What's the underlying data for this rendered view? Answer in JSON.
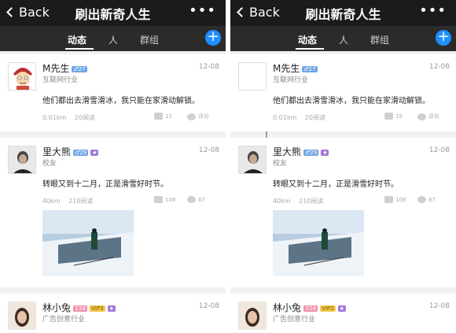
{
  "header": {
    "back_label": "Back",
    "title": "刷出新奇人生",
    "more": "•••"
  },
  "tabs": [
    {
      "label": "动态"
    },
    {
      "label": "人"
    },
    {
      "label": "群组"
    }
  ],
  "plus": "+",
  "posts": [
    {
      "name": "M先生",
      "badges": [
        "♂27"
      ],
      "sub": "互联网行业",
      "date": "12-08",
      "text": "他们都出去滑雪滑冰，我只能在家滑动解锁。",
      "distance": "0.01km",
      "reads": "20阅读",
      "likes": "15",
      "comments": "评论"
    },
    {
      "name": "里大熊",
      "badges": [
        "♂29",
        "★"
      ],
      "sub": "校友",
      "date": "12-08",
      "text": "转眼又到十二月，正是滑雪好时节。",
      "distance": "40km",
      "reads": "210阅读",
      "likes": "108",
      "comments": "87"
    },
    {
      "name": "林小兔",
      "badges": [
        "♀28",
        "VIP3",
        "★"
      ],
      "sub": "广告创意行业",
      "date": "12-08"
    }
  ]
}
